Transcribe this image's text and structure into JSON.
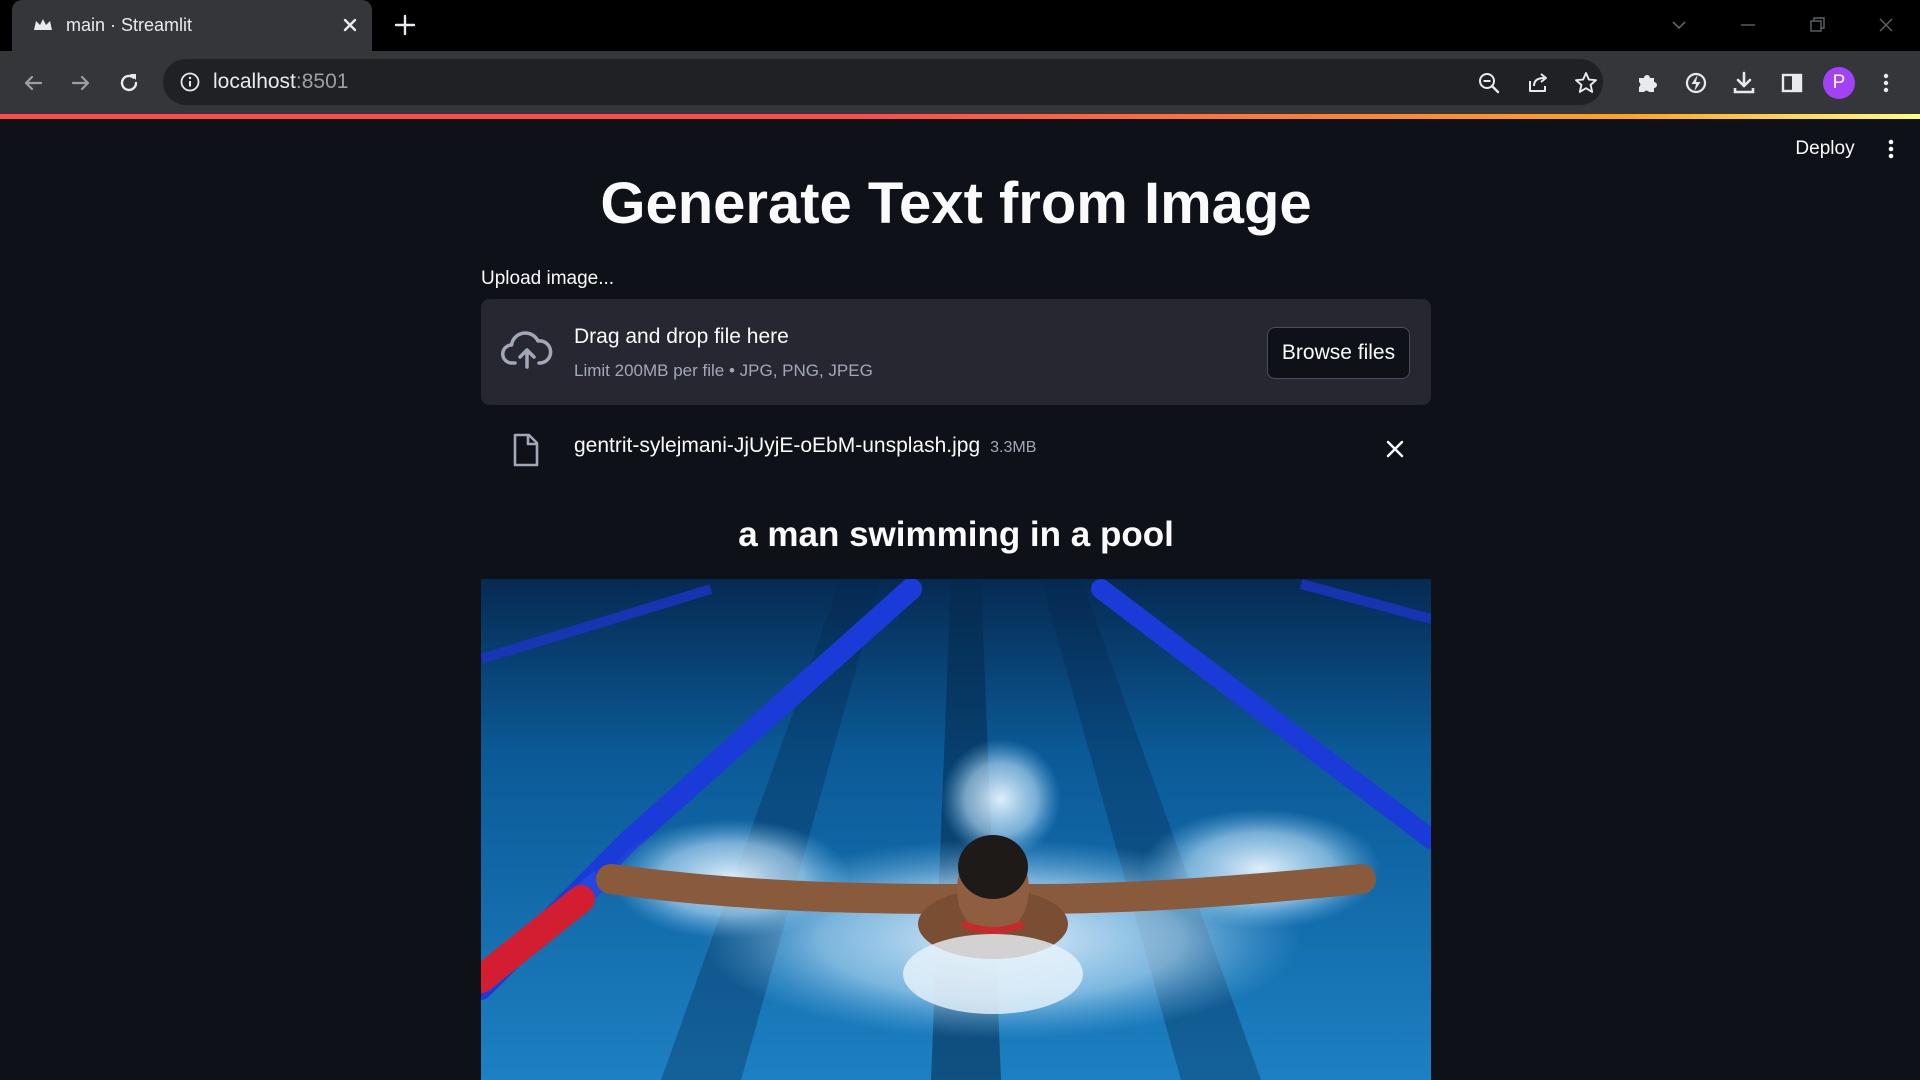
{
  "browser": {
    "tab_title": "main · Streamlit",
    "url_host": "localhost",
    "url_port": ":8501",
    "profile_initial": "P",
    "tab_favicon_icon": "streamlit-crown-icon",
    "profile_color": "#a142f4"
  },
  "app": {
    "deploy_label": "Deploy",
    "title": "Generate Text from Image",
    "uploader": {
      "label": "Upload image...",
      "drop_title": "Drag and drop file here",
      "limit_text": "Limit 200MB per file • JPG, PNG, JPEG",
      "browse_label": "Browse files"
    },
    "uploaded_file": {
      "name": "gentrit-sylejmani-JjUyjE-oEbM-unsplash.jpg",
      "size": "3.3MB"
    },
    "caption": "a man swimming in a pool",
    "accent_color": "#ff4b4b",
    "background_color": "#0e1117"
  }
}
